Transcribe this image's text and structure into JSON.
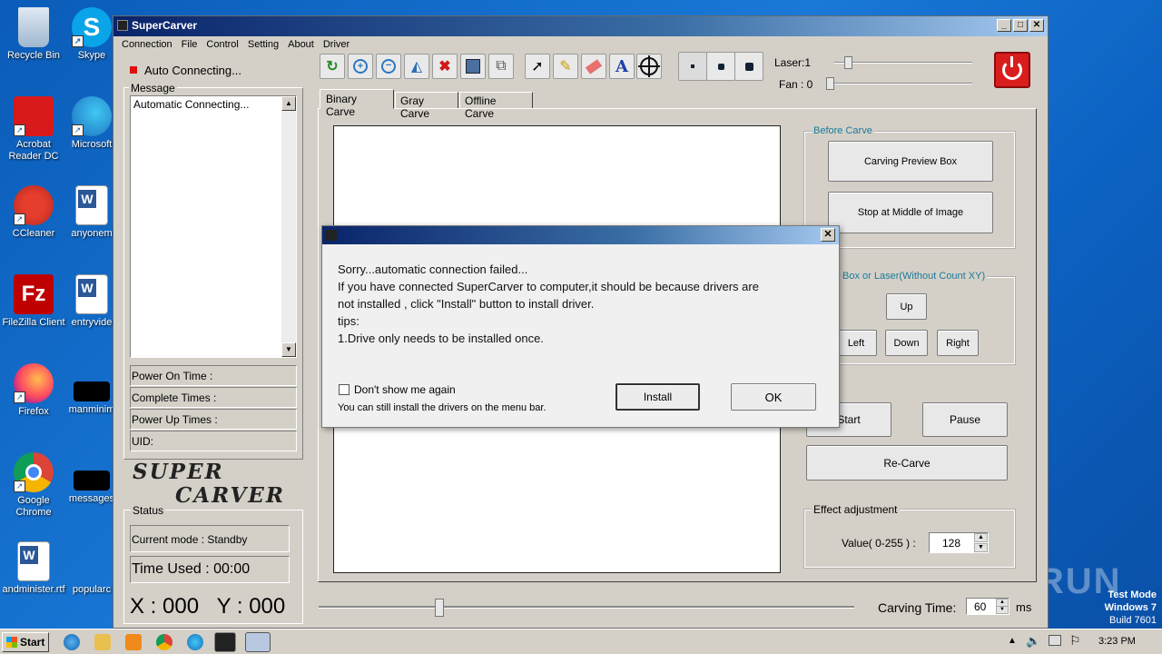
{
  "desktop": {
    "icons": [
      {
        "label": "Recycle Bin"
      },
      {
        "label": "Skype"
      },
      {
        "label": "Acrobat Reader DC"
      },
      {
        "label": "Microsoft"
      },
      {
        "label": "CCleaner"
      },
      {
        "label": "anyonem"
      },
      {
        "label": "FileZilla Client"
      },
      {
        "label": "entryvide"
      },
      {
        "label": "Firefox"
      },
      {
        "label": "manminim"
      },
      {
        "label": "Google Chrome"
      },
      {
        "label": "messages"
      },
      {
        "label": "andminister.rtf"
      },
      {
        "label": "popularc"
      }
    ],
    "watermark": "ANY RUN",
    "test_mode": [
      "Test Mode",
      "Windows 7",
      "Build 7601"
    ]
  },
  "window": {
    "title": "SuperCarver",
    "controls": {
      "minimize": "_",
      "maximize": "□",
      "close": "✕"
    },
    "menu": [
      "Connection",
      "File",
      "Control",
      "Setting",
      "About",
      "Driver"
    ]
  },
  "left_panel": {
    "status_line": "Auto Connecting...",
    "message_label": "Message",
    "message_text": "Automatic Connecting...",
    "info_rows": [
      "Power On Time :",
      "Complete Times :",
      "Power Up Times :",
      "UID:"
    ],
    "logo_line1": "SUPER",
    "logo_line2": "CARVER",
    "status_label": "Status",
    "current_mode": "Current mode : Standby",
    "time_used": "Time Used :  00:00",
    "coords": "X : 000   Y : 000"
  },
  "toolbar": {
    "tools": [
      "open-icon",
      "zoom-in-icon",
      "zoom-out-icon",
      "flip-icon",
      "delete-icon",
      "save-icon",
      "transform-icon",
      "select-icon",
      "pencil-icon",
      "eraser-icon",
      "text-icon",
      "crosshair-icon"
    ],
    "dot_sizes": [
      "small-dot-icon",
      "medium-dot-icon",
      "large-dot-icon"
    ],
    "laser_label": "Laser:1",
    "fan_label": "Fan : 0",
    "laser_level": 0.08,
    "fan_level": 0.0
  },
  "tabs": [
    "Binary Carve",
    "Gray Carve",
    "Offline Carve"
  ],
  "right_panel": {
    "before_carve_label": "Before Carve",
    "carving_preview_box": "Carving Preview Box",
    "stop_middle": "Stop at Middle of Image",
    "move_label": "Box or Laser(Without Count XY)",
    "up": "Up",
    "left": "Left",
    "down": "Down",
    "right": "Right",
    "start": "Start",
    "pause": "Pause",
    "recarve": "Re-Carve",
    "effect_label": "Effect adjustment",
    "value_label": "Value( 0-255 ) :",
    "value": "128"
  },
  "bottom": {
    "carving_time_label": "Carving Time:",
    "carving_time_value": "60",
    "carving_time_unit": "ms",
    "slider_level": 0.22
  },
  "dialog": {
    "lines": [
      "Sorry...automatic connection failed...",
      "If you have connected SuperCarver to computer,it should be because drivers are",
      "not installed , click \"Install\" button to install driver.",
      "tips:",
      "1.Drive only needs to be installed once."
    ],
    "checkbox_label": "Don't show me again",
    "hint": "You can still install the drivers on the menu bar.",
    "install": "Install",
    "ok": "OK",
    "close": "✕"
  },
  "taskbar": {
    "start": "Start",
    "clock": "3:23 PM"
  }
}
